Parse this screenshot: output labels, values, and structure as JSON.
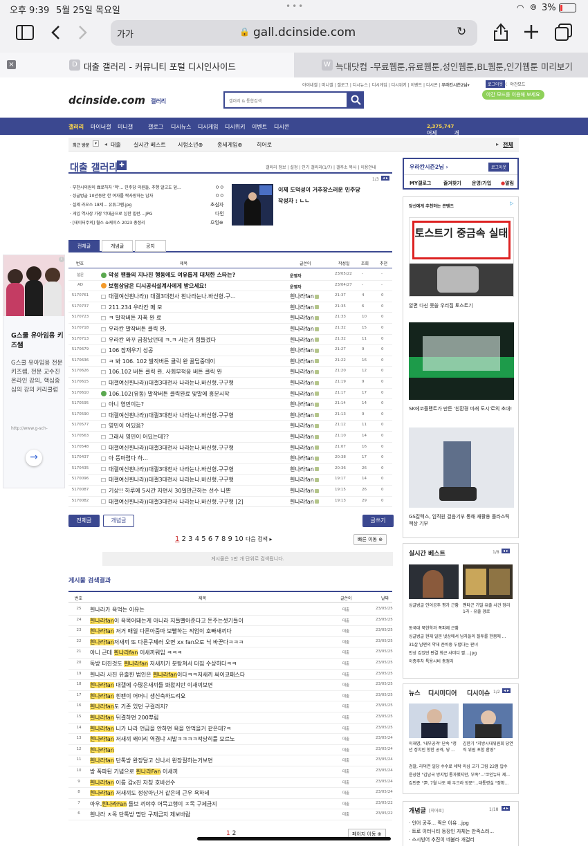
{
  "status": {
    "time": "오후 9:39",
    "date": "5월 25일 목요일",
    "battery": "3%"
  },
  "browser": {
    "text_size": "가가",
    "url": "gall.dcinside.com"
  },
  "tabs": [
    {
      "label": "대출 갤러리 - 커뮤니티 포털 디시인사이드",
      "favicon": "D"
    },
    {
      "label": "늑대닷컴 -무료웹툰,유료웹툰,성인웹툰,BL웹툰,인기웹툰 미리보기",
      "favicon": "W"
    }
  ],
  "header": {
    "logo": "dcinside.com",
    "logo_sub": "갤러리",
    "search_placeholder": "갤러리 & 통합검색",
    "top_links": [
      "아이네갤",
      "미니갤",
      "갤로그",
      "디시뉴스",
      "디시게임",
      "디시위키",
      "이벤트",
      "디시콘",
      "우라칸시즌2님"
    ],
    "login": "로그아웃",
    "night": "야간모드",
    "night_tip": "야간 모드를 이용해 보세요"
  },
  "gnb": {
    "items": [
      "갤러리",
      "마이너갤",
      "미니갤",
      "갤로그",
      "디시뉴스",
      "디시게임",
      "디시위키",
      "이벤트",
      "디시콘"
    ],
    "comments_prefix": "어제",
    "comments_count": "2,375,747",
    "comments_suffix": "개 댓글 등록"
  },
  "subnav": {
    "recent": "최근 방문",
    "items": [
      "대출",
      "실시간 베스트",
      "시험소년⊕",
      "종세게임⊕",
      "히어로"
    ],
    "all": "전체"
  },
  "gallery": {
    "title": "대출 갤러리",
    "menu": [
      "갤러리 정보",
      "설정",
      "인기 갤러리(1/7)",
      "갤주소 복사",
      "이용안내"
    ],
    "pager": "1/3",
    "notices": [
      {
        "text": "· 부천시의원이 뾰로하자 '학'... 민주당 의원들, 추행 알고도 덮...",
        "user": "ㅇㅇ"
      },
      {
        "text": "· 싱글벙글 10년동안 한 여자를 짝사랑하는 남자",
        "user": "ㅇㅇ"
      },
      {
        "text": "· 실제 라오스 18세... 유튜그램.jpg",
        "user": "초심자"
      },
      {
        "text": "· 게임 역사상 가장 악대금으로 심한 빌런....JPG",
        "user": "다인"
      },
      {
        "text": "· [데이터주의] 월스 쇼케이스 2023 총정리",
        "user": "으잉⊕"
      }
    ],
    "feature_title": "이제 도덕성이 거추장스러운 민주당",
    "feature_author": "작성자 : ㄴㄴ"
  },
  "board_tabs": [
    "전체글",
    "개념글",
    "공지"
  ],
  "table_headers": {
    "no": "번호",
    "title": "제목",
    "writer": "글쓴이",
    "date": "작성일",
    "views": "조회",
    "recommend": "추천"
  },
  "posts": [
    {
      "no": "설문",
      "title": "악성 팬들의 지나친 행동에도 여유롭게 대처한 스타는?",
      "writer": "운영자",
      "date": "23/05/22",
      "views": "-",
      "rec": "-",
      "bold": true,
      "icon": "green"
    },
    {
      "no": "AD",
      "title": "보험상담은 디시공식설계사에게 받으세요!",
      "writer": "운영자",
      "date": "23/04/27",
      "views": "-",
      "rec": "-",
      "bold": true,
      "icon": "orange"
    },
    {
      "no": "5170761",
      "title": "대갤여신흰나라)) 대갤3대천사 흰나라눈나.바신형.구...",
      "writer": "흰나라fan",
      "date": "21:37",
      "views": "4",
      "rec": "0"
    },
    {
      "no": "5170737",
      "title": "211.234 우라칸 메 모",
      "writer": "흰나라fan",
      "date": "21:35",
      "views": "6",
      "rec": "0"
    },
    {
      "no": "5170723",
      "title": "ㅋ 발작버튼 자폭 완 료",
      "writer": "흰나라fan",
      "date": "21:33",
      "views": "10",
      "rec": "0"
    },
    {
      "no": "5170718",
      "title": "우라칸 발작버튼 클릭 완.",
      "writer": "흰나라fan",
      "date": "21:32",
      "views": "15",
      "rec": "0"
    },
    {
      "no": "5170713",
      "title": "우라칸 와꾸 금창났던데 ㅋ.ㅋ 사는거 힘들겠다",
      "writer": "흰나라fan",
      "date": "21:32",
      "views": "11",
      "rec": "0"
    },
    {
      "no": "5170679",
      "title": "106 잠재우기 성공",
      "writer": "흰나라fan",
      "date": "21:27",
      "views": "9",
      "rec": "0"
    },
    {
      "no": "5170636",
      "title": "ㅋ 봐 106. 102 발작버튼 클릭 완 꿀팁중데이",
      "writer": "흰나라fan",
      "date": "21:22",
      "views": "16",
      "rec": "0"
    },
    {
      "no": "5170626",
      "title": "106.102 버튼 클릭 완. 사회부적응 버튼 클릭 완",
      "writer": "흰나라fan",
      "date": "21:20",
      "views": "12",
      "rec": "0"
    },
    {
      "no": "5170615",
      "title": "대갤여신흰나라))대갤3대천사 나라눈나.바신형.구구형",
      "writer": "흰나라fan",
      "date": "21:19",
      "views": "9",
      "rec": "0"
    },
    {
      "no": "5170610",
      "title": "106.102(유동) 발작버튼 클릭완료 맞말에 흥분시작",
      "writer": "흰나라fan",
      "date": "21:17",
      "views": "17",
      "rec": "0",
      "icon": "green"
    },
    {
      "no": "5170595",
      "title": "아니 영민이는?",
      "writer": "흰나라fan",
      "date": "21:14",
      "views": "14",
      "rec": "0"
    },
    {
      "no": "5170590",
      "title": "대갤여신흰나라))대갤3대천사 나라눈나.바신형.구구형",
      "writer": "흰나라fan",
      "date": "21:13",
      "views": "9",
      "rec": "0"
    },
    {
      "no": "5170577",
      "title": "영민이 어딨음?",
      "writer": "흰나라fan",
      "date": "21:12",
      "views": "11",
      "rec": "0"
    },
    {
      "no": "5170563",
      "title": "그래서 영민이 어딨는데??",
      "writer": "흰나라fan",
      "date": "21:10",
      "views": "14",
      "rec": "0"
    },
    {
      "no": "5170548",
      "title": "대갤여신흰나라))대갤3대천사 나라눈나.바신형.구구형",
      "writer": "흰나라fan",
      "date": "21:07",
      "views": "16",
      "rec": "0"
    },
    {
      "no": "5170437",
      "title": "아 뚱마렵다 하...",
      "writer": "흰나라fan",
      "date": "20:38",
      "views": "17",
      "rec": "0"
    },
    {
      "no": "5170435",
      "title": "대갤여신흰나라))대갤3대천사 나라눈나.바신형.구구형",
      "writer": "흰나라fan",
      "date": "20:36",
      "views": "26",
      "rec": "0"
    },
    {
      "no": "5170096",
      "title": "대갤여신흰나라))대갤3대천사 나라눈나.바신형.구구형",
      "writer": "흰나라fan",
      "date": "19:17",
      "views": "14",
      "rec": "0"
    },
    {
      "no": "5170087",
      "title": "기상!! 하루에 5시간 자면서 30일만근하는 선수 나뽄",
      "writer": "흰나라fan",
      "date": "19:15",
      "views": "26",
      "rec": "0"
    },
    {
      "no": "5170082",
      "title": "대갤여신흰나라))대갤3대천사 나라눈나.바신형.구구형 [2]",
      "writer": "흰나라fan",
      "date": "19:13",
      "views": "29",
      "rec": "0"
    }
  ],
  "bottom_buttons": {
    "all": "전체글",
    "concept": "개념글",
    "write": "글쓰기"
  },
  "pagination": {
    "pages": [
      "1",
      "2",
      "3",
      "4",
      "5",
      "6",
      "7",
      "8",
      "9",
      "10"
    ],
    "next": "다음 검색 ▸",
    "quick": "빠른 이동 ⊕"
  },
  "search_notice": "게시물은 1만 개 단위로 검색됩니다.",
  "search_results": {
    "title": "게시물 검색결과",
    "headers": {
      "no": "번호",
      "title": "제목",
      "writer": "글쓴이",
      "date": "날짜"
    },
    "rows": [
      {
        "no": "25",
        "pre": "흰나라가 욕먹는 이유는",
        "hl": "",
        "post": "",
        "cat": "대출",
        "date": "23/05/25"
      },
      {
        "no": "24",
        "pre": "",
        "hl": "흰나라fan",
        "post": "이 욕목어돼는게 아니라 지들빨아준다고 돈주는셋기들이",
        "cat": "대출",
        "date": "23/05/25"
      },
      {
        "no": "23",
        "pre": "",
        "hl": "흰나라fan",
        "post": " 저거 매일 다른아줌마 보빨하는 직업이 호빠새끼다",
        "cat": "대출",
        "date": "23/05/25"
      },
      {
        "no": "22",
        "pre": "",
        "hl": "흰나라fan",
        "post": "저새끼 또 다른구제러 오면 xx fan으로 닉 바꾼다ㅋㅋㅋ",
        "cat": "대출",
        "date": "23/05/25"
      },
      {
        "no": "21",
        "pre": "아니 근데 ",
        "hl": "흰나라fan",
        "post": " 이새끼뭐임 ㅋㅋㅋ",
        "cat": "대출",
        "date": "23/05/25"
      },
      {
        "no": "20",
        "pre": "독방 터진것도 ",
        "hl": "흰나라fan",
        "post": " 저새끼가 분탕쳐서 터짐 수상하다ㅋㅋ",
        "cat": "대출",
        "date": "23/05/25"
      },
      {
        "no": "19",
        "pre": "흰나라 사진 유출한 범인은 ",
        "hl": "흰나라fan",
        "post": "이다ㅋㅋ저새끼 싸이코패스다",
        "cat": "대출",
        "date": "23/05/25"
      },
      {
        "no": "18",
        "pre": "",
        "hl": "흰나라fan",
        "post": " 대갤에 수많은새끼들 봐왔지만 이새끼보면",
        "cat": "대출",
        "date": "23/05/25"
      },
      {
        "no": "17",
        "pre": "",
        "hl": "흰나라fan",
        "post": " 흰팬이 어머니 생신축하드려요",
        "cat": "대출",
        "date": "23/05/25"
      },
      {
        "no": "16",
        "pre": "",
        "hl": "흰나라fan",
        "post": "도 기존 있던 구걸러지?",
        "cat": "대출",
        "date": "23/05/25"
      },
      {
        "no": "15",
        "pre": "",
        "hl": "흰나라fan",
        "post": " 뒤결하면 200뿌림",
        "cat": "대출",
        "date": "23/05/25"
      },
      {
        "no": "14",
        "pre": "",
        "hl": "흰나라fan",
        "post": " 니가 나라 언급을 안하면 욕을 안먹을거 같은데?ㅋ",
        "cat": "대출",
        "date": "23/05/25"
      },
      {
        "no": "13",
        "pre": "",
        "hl": "흰나라fan",
        "post": " 저새끼 왜이리 역겹냐 시발ㅋㅋㅋㅋ적당히를 모르노",
        "cat": "대출",
        "date": "23/05/24"
      },
      {
        "no": "12",
        "pre": "",
        "hl": "흰나라fan",
        "post": "",
        "cat": "대출",
        "date": "23/05/24"
      },
      {
        "no": "11",
        "pre": "",
        "hl": "흰나라fan",
        "post": " 단톡방 완장달고 신나서 완장질하는거보면",
        "cat": "대출",
        "date": "23/05/24"
      },
      {
        "no": "10",
        "pre": "방 폭파된 기념으로 ",
        "hl": "흰나라Fan",
        "post": " 이새끼",
        "cat": "대출",
        "date": "23/05/24"
      },
      {
        "no": "9",
        "pre": "",
        "hl": "흰나라fan",
        "post": " 이름 갑x진 자칭 호바선수",
        "cat": "대출",
        "date": "23/05/24"
      },
      {
        "no": "8",
        "pre": "",
        "hl": "흰나라fan",
        "post": " 저새끼도 정상아닌거 같은데 근우 욕하네",
        "cat": "대출",
        "date": "23/05/24"
      },
      {
        "no": "7",
        "pre": "아우.",
        "hl": "흰나라Fan",
        "post": " 돌브 끼야후 어묵고행이 ㅈ목 구제금지",
        "cat": "대출",
        "date": "23/05/22"
      },
      {
        "no": "6",
        "pre": "흰나라 ㅈ목 단톡방 명단 구제금지 제보바람",
        "hl": "",
        "post": "",
        "cat": "대출",
        "date": "23/05/22"
      }
    ],
    "pages": [
      "1",
      "2"
    ],
    "move": "페이지 이동 ⊕"
  },
  "left_ad": {
    "title": "G스쿨 유아임용 키즈쌤",
    "desc": "G스쿨 유아임용 전문 키즈쌤, 전문 교수진 온라인 강의, 핵심중심의 강의 커리큘럼",
    "url": "http://www.g-sch-"
  },
  "right": {
    "user": "우라칸시즌2님",
    "logout": "로그아웃",
    "links": [
      "MY갤로그",
      "즐겨찾기",
      "운영/가입",
      "알림"
    ],
    "recommend_title": "당신에게 추천하는 콘텐츠",
    "contents": [
      {
        "image_text": "토스트기 중금속 실태",
        "caption": "알면 다신 못쓸 우리집 토스트기"
      },
      {
        "caption": "SK에코플랜트가 만든 '친환경 미래 도시'로의 초대!"
      },
      {
        "caption": "GS칼텍스, 임직원 걸음기부 통해 재활용 플라스틱 책상 기부"
      }
    ],
    "best": {
      "title": "실시간 베스트",
      "pager": "1/8",
      "items": [
        {
          "caption": "싱글벙글 인어공주 평가 근황"
        },
        {
          "caption": "팬타곤 기밀 유출 사건 정리 1라 - 유출 경로"
        }
      ],
      "list": [
        "동국대 북한학과 폭파제 근황",
        "싱글벙글 현재 일본 넷상에서 남자들의 질투를 한몸에 ...",
        "31살 남편의 약데 준비중 두렵다는 판녀",
        "안상 갑었던 판결 최근 사미디 짤....jpg",
        "이종주차 특용시비 총정리"
      ]
    },
    "news": {
      "tabs": [
        "뉴스",
        "디시미디어",
        "디시이슈"
      ],
      "pager": "1/2",
      "items": [
        {
          "caption": "이재명, '내부공격' 단속 \"청년 정치인 향한 공격, 당 ..."
        },
        {
          "caption": "김한기 \"지방시대위원회 당연직 위원 포함 환영\""
        }
      ],
      "list": [
        "검찰, 라덕연 일당 수수료 세탁 의심 고가 그림 22점 압수",
        "윤상현 \"김남국 방지법 통과했지만, 부족\"...'코인뉴터 제...",
        "김민준 \"尹, 7월 나토 때 우크라 방문\"...대통령실 \"정확..."
      ]
    },
    "concept": {
      "title": "개념글",
      "sub": "[히어로]",
      "pager": "1/18",
      "list": [
        "· 인어 공주... 찍은 이유 ..jpg",
        "· 트로 이터니티 등장인 자체는 만족스러...",
        "· 스시빙어 추진이 네불라 개걸리"
      ]
    }
  }
}
